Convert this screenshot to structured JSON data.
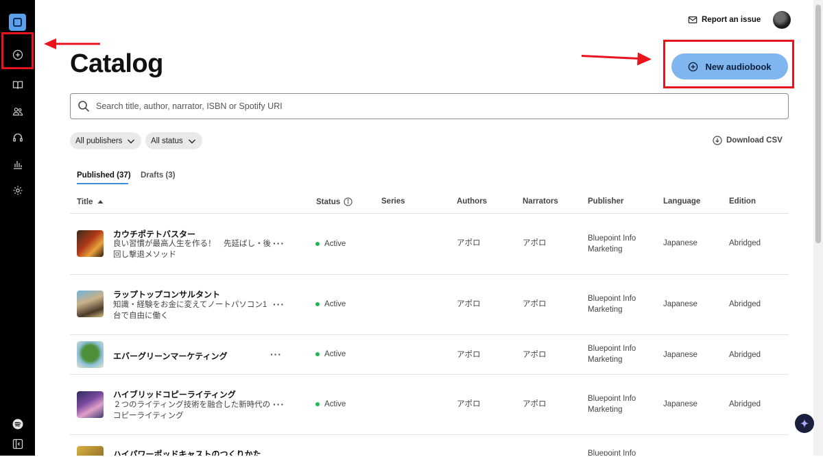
{
  "sidebar": {
    "logo": "spotify-for-authors-logo",
    "items": [
      {
        "name": "new-audiobook-nav",
        "icon": "plus-circle-icon"
      },
      {
        "name": "catalog-nav",
        "icon": "book-icon"
      },
      {
        "name": "people-nav",
        "icon": "people-icon"
      },
      {
        "name": "support-nav",
        "icon": "headset-icon"
      },
      {
        "name": "analytics-nav",
        "icon": "bar-chart-icon"
      },
      {
        "name": "settings-nav",
        "icon": "gear-icon"
      }
    ],
    "bottom": [
      {
        "name": "spotify-nav",
        "icon": "spotify-icon"
      },
      {
        "name": "collapse-sidebar",
        "icon": "sidebar-toggle-icon"
      }
    ]
  },
  "header": {
    "report_issue": "Report an issue",
    "page_title": "Catalog",
    "new_button": "New audiobook"
  },
  "search": {
    "placeholder": "Search title, author, narrator, ISBN or Spotify URI"
  },
  "filters": {
    "publishers": "All publishers",
    "status": "All status",
    "download": "Download CSV"
  },
  "tabs": [
    {
      "label": "Published (37)",
      "active": true
    },
    {
      "label": "Drafts (3)",
      "active": false
    }
  ],
  "columns": {
    "title": "Title",
    "status": "Status",
    "series": "Series",
    "authors": "Authors",
    "narrators": "Narrators",
    "publisher": "Publisher",
    "language": "Language",
    "edition": "Edition"
  },
  "rows": [
    {
      "title": "カウチポテトバスター",
      "subtitle": "良い習慣が最高人生を作る！　先延ばし・後回し撃退メソッド",
      "status": "Active",
      "series": "",
      "authors": "アポロ",
      "narrators": "アポロ",
      "publisher": "Bluepoint Info Marketing",
      "language": "Japanese",
      "edition": "Abridged"
    },
    {
      "title": "ラップトップコンサルタント",
      "subtitle": "知識・経験をお金に変えてノートパソコン1台で自由に働く",
      "status": "Active",
      "series": "",
      "authors": "アポロ",
      "narrators": "アポロ",
      "publisher": "Bluepoint Info Marketing",
      "language": "Japanese",
      "edition": "Abridged"
    },
    {
      "title": "エバーグリーンマーケティング",
      "subtitle": "",
      "status": "Active",
      "series": "",
      "authors": "アポロ",
      "narrators": "アポロ",
      "publisher": "Bluepoint Info Marketing",
      "language": "Japanese",
      "edition": "Abridged"
    },
    {
      "title": "ハイブリッドコピーライティング",
      "subtitle": "２つのライティング技術を融合した新時代のコピーライティング",
      "status": "Active",
      "series": "",
      "authors": "アポロ",
      "narrators": "アポロ",
      "publisher": "Bluepoint Info Marketing",
      "language": "Japanese",
      "edition": "Abridged"
    },
    {
      "title": "ハイパワーポッドキャストのつくりかた",
      "subtitle": "",
      "status": "",
      "series": "",
      "authors": "",
      "narrators": "",
      "publisher": "Bluepoint Info",
      "language": "",
      "edition": ""
    }
  ]
}
